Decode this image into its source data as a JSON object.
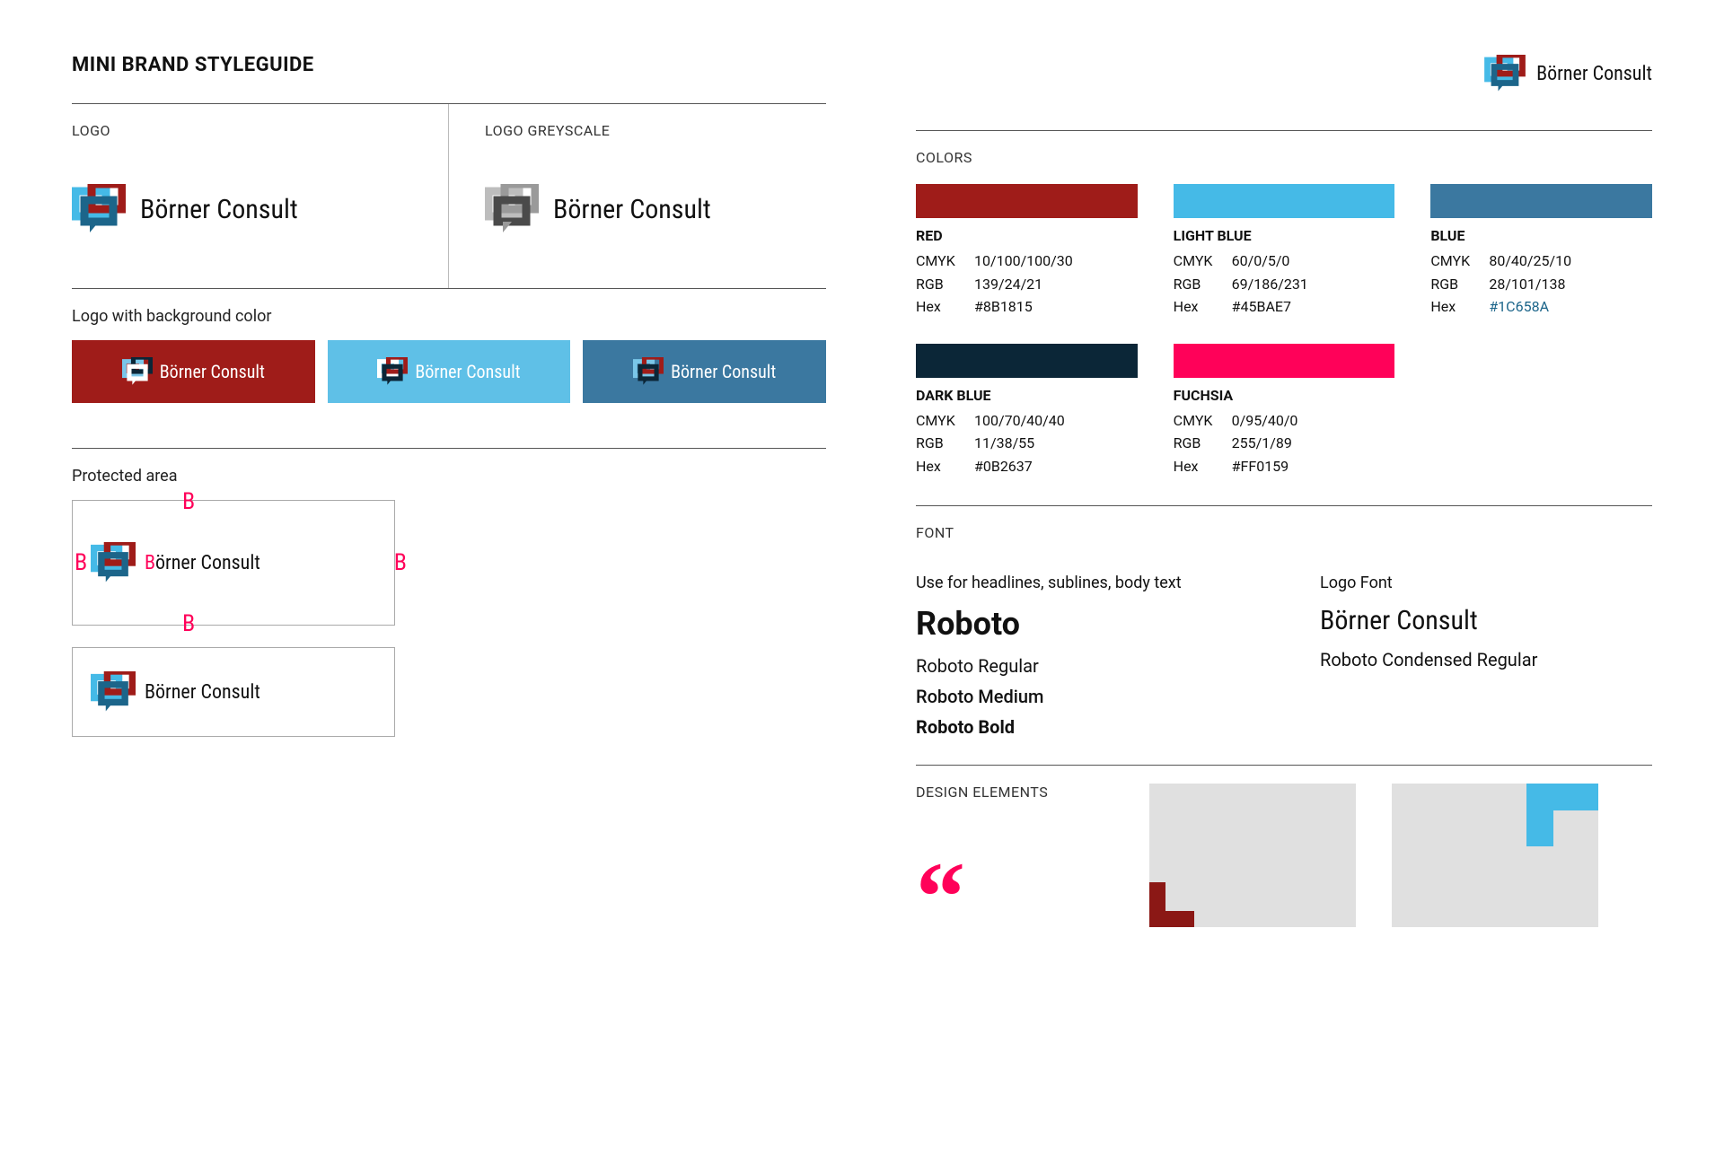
{
  "page_title": "MINI BRAND STYLEGUIDE",
  "brand_name": "Börner Consult",
  "sections": {
    "logo": "LOGO",
    "logo_grey": "LOGO GREYSCALE",
    "logo_bg": "Logo with background color",
    "protected": "Protected area",
    "colors": "COLORS",
    "font": "FONT",
    "design": "DESIGN ELEMENTS"
  },
  "brand_colors": {
    "red": "#9F1C19",
    "lightblue": "#45BAE7",
    "blue": "#3B78A0",
    "darkblue": "#0B2637",
    "fuchsia": "#FF0159"
  },
  "color_specs": [
    {
      "name": "RED",
      "swatch": "#9F1C19",
      "cmyk": "10/100/100/30",
      "rgb": "139/24/21",
      "hex": "#8B1815"
    },
    {
      "name": "LIGHT BLUE",
      "swatch": "#45BAE7",
      "cmyk": "60/0/5/0",
      "rgb": "69/186/231",
      "hex": "#45BAE7"
    },
    {
      "name": "BLUE",
      "swatch": "#3B78A0",
      "cmyk": "80/40/25/10",
      "rgb": "28/101/138",
      "hex": "#1C658A",
      "hex_link": true
    },
    {
      "name": "DARK BLUE",
      "swatch": "#0B2637",
      "cmyk": "100/70/40/40",
      "rgb": "11/38/55",
      "hex": "#0B2637"
    },
    {
      "name": "FUCHSIA",
      "swatch": "#FF0159",
      "cmyk": "0/95/40/0",
      "rgb": "255/1/89",
      "hex": "#FF0159"
    }
  ],
  "spec_labels": {
    "cmyk": "CMYK",
    "rgb": "RGB",
    "hex": "Hex"
  },
  "fonts": {
    "hint_main": "Use for headlines, sublines, body text",
    "hint_logo": "Logo Font",
    "main_name": "Roboto",
    "variants": [
      "Roboto Regular",
      "Roboto Medium",
      "Roboto Bold"
    ],
    "logo_variant": "Roboto Condensed Regular"
  },
  "protected_brand": {
    "first": "B",
    "rest": "örner Consult"
  },
  "quote_glyph": "“"
}
